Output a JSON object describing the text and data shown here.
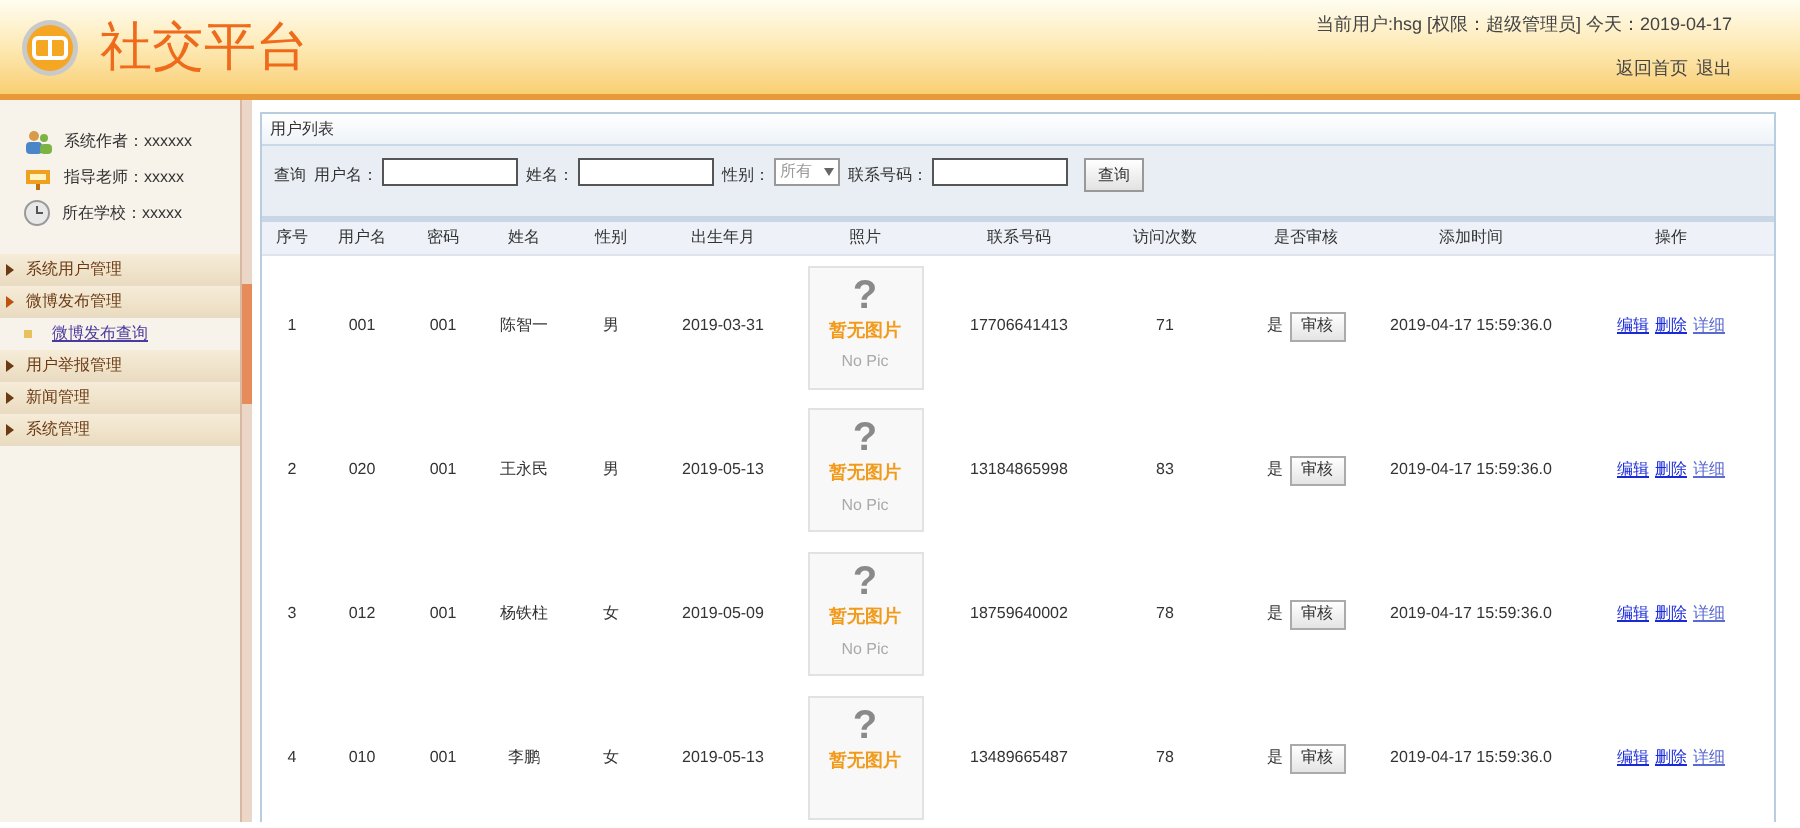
{
  "header": {
    "title": "社交平台",
    "user_info": "当前用户:hsg [权限：超级管理员] 今天：2019-04-17",
    "links": [
      "返回首页",
      "退出"
    ]
  },
  "sidebar": {
    "info": [
      {
        "kind": "people",
        "text": "系统作者：xxxxxx"
      },
      {
        "kind": "teacher",
        "text": "指导老师：xxxxx"
      },
      {
        "kind": "clock",
        "text": "所在学校：xxxxx"
      }
    ],
    "menu": [
      {
        "label": "系统用户管理",
        "expanded": false
      },
      {
        "label": "微博发布管理",
        "expanded": true,
        "children": [
          {
            "label": "微博发布查询"
          }
        ]
      },
      {
        "label": "用户举报管理",
        "expanded": false
      },
      {
        "label": "新闻管理",
        "expanded": false
      },
      {
        "label": "系统管理",
        "expanded": false
      }
    ]
  },
  "panel": {
    "title": "用户列表",
    "query": {
      "label": "查询",
      "fields": [
        {
          "kind": "text",
          "label": "用户名："
        },
        {
          "kind": "text",
          "label": "姓名："
        },
        {
          "kind": "select",
          "label": "性别：",
          "value": "所有"
        },
        {
          "kind": "text",
          "label": "联系号码："
        }
      ],
      "button": "查询"
    },
    "table": {
      "columns": [
        "序号",
        "用户名",
        "密码",
        "姓名",
        "性别",
        "出生年月",
        "照片",
        "联系号码",
        "访问次数",
        "是否审核",
        "添加时间",
        "操作"
      ],
      "rows": [
        {
          "cells": [
            "1",
            "001",
            "001",
            "陈智一",
            "男",
            "2019-03-31"
          ],
          "photo": {
            "mark": "?",
            "caption": "暂无图片",
            "sub": "No Pic"
          },
          "phone": "17706641413",
          "visits": "71",
          "audited": "是",
          "audit_button": "审核",
          "added": "2019-04-17 15:59:36.0",
          "actions": [
            "编辑",
            "删除",
            "详细"
          ]
        },
        {
          "cells": [
            "2",
            "020",
            "001",
            "王永民",
            "男",
            "2019-05-13"
          ],
          "photo": {
            "mark": "?",
            "caption": "暂无图片",
            "sub": "No Pic"
          },
          "phone": "13184865998",
          "visits": "83",
          "audited": "是",
          "audit_button": "审核",
          "added": "2019-04-17 15:59:36.0",
          "actions": [
            "编辑",
            "删除",
            "详细"
          ]
        },
        {
          "cells": [
            "3",
            "012",
            "001",
            "杨铁柱",
            "女",
            "2019-05-09"
          ],
          "photo": {
            "mark": "?",
            "caption": "暂无图片",
            "sub": "No Pic"
          },
          "phone": "18759640002",
          "visits": "78",
          "audited": "是",
          "audit_button": "审核",
          "added": "2019-04-17 15:59:36.0",
          "actions": [
            "编辑",
            "删除",
            "详细"
          ]
        },
        {
          "cells": [
            "4",
            "010",
            "001",
            "李鹏",
            "女",
            "2019-05-13"
          ],
          "photo": {
            "mark": "?",
            "caption": "暂无图片"
          },
          "phone": "13489665487",
          "visits": "78",
          "audited": "是",
          "audit_button": "审核",
          "added": "2019-04-17 15:59:36.0",
          "actions": [
            "编辑",
            "删除",
            "详细"
          ]
        }
      ]
    }
  }
}
